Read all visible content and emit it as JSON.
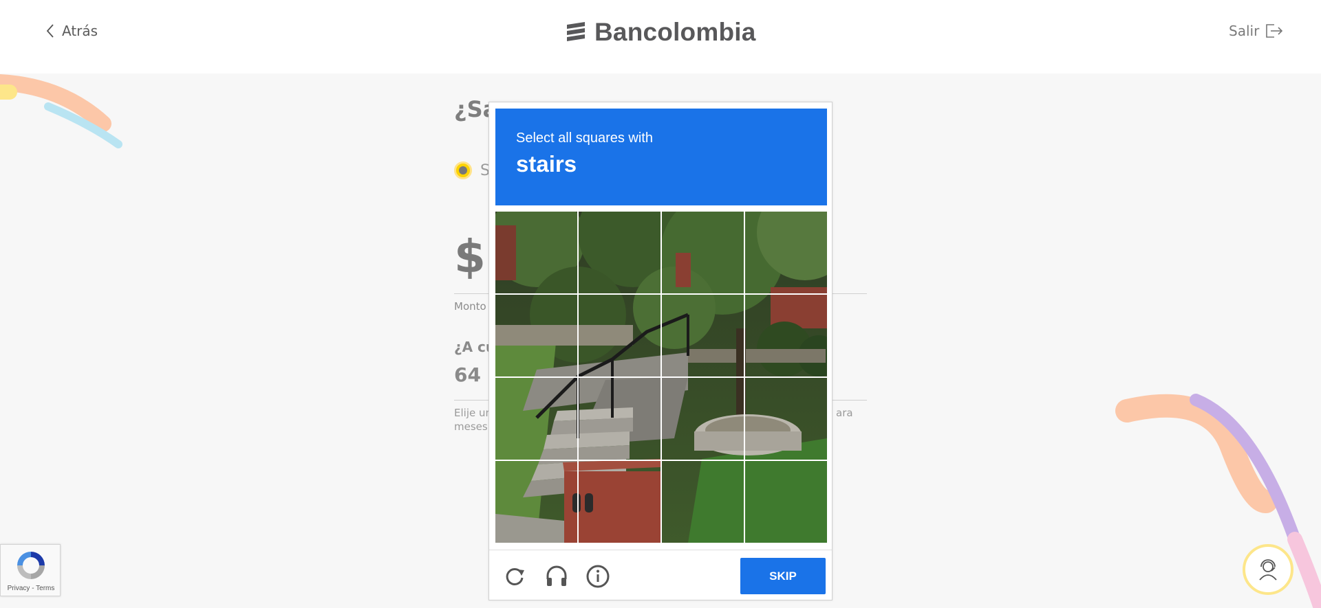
{
  "header": {
    "back_label": "Atrás",
    "brand": "Bancolombia",
    "logout_label": "Salir"
  },
  "form": {
    "question": "¿Sa",
    "radio_label": "Si",
    "amount_prefix": "$",
    "amount_caption": "Monto",
    "term_question": "¿A cu",
    "term_value": "64",
    "help_line1": "Elije un",
    "help_line2": "meses",
    "help_right": "ara"
  },
  "captcha": {
    "prompt": "Select all squares with",
    "target": "stairs",
    "skip_label": "SKIP",
    "tiles": [
      "1",
      "2",
      "3",
      "4",
      "5",
      "6",
      "7",
      "8",
      "9",
      "10",
      "11",
      "12",
      "13",
      "14",
      "15",
      "16"
    ]
  },
  "recaptcha_badge": {
    "links": "Privacy - Terms"
  },
  "colors": {
    "captcha_blue": "#1a73e8",
    "brand_gray": "#58585a",
    "accent_yellow": "#fdd300"
  },
  "icons": {
    "back": "chevron-left-icon",
    "logout": "logout-icon",
    "reload": "reload-icon",
    "audio": "headphones-icon",
    "info": "info-icon",
    "help": "support-agent-icon"
  }
}
